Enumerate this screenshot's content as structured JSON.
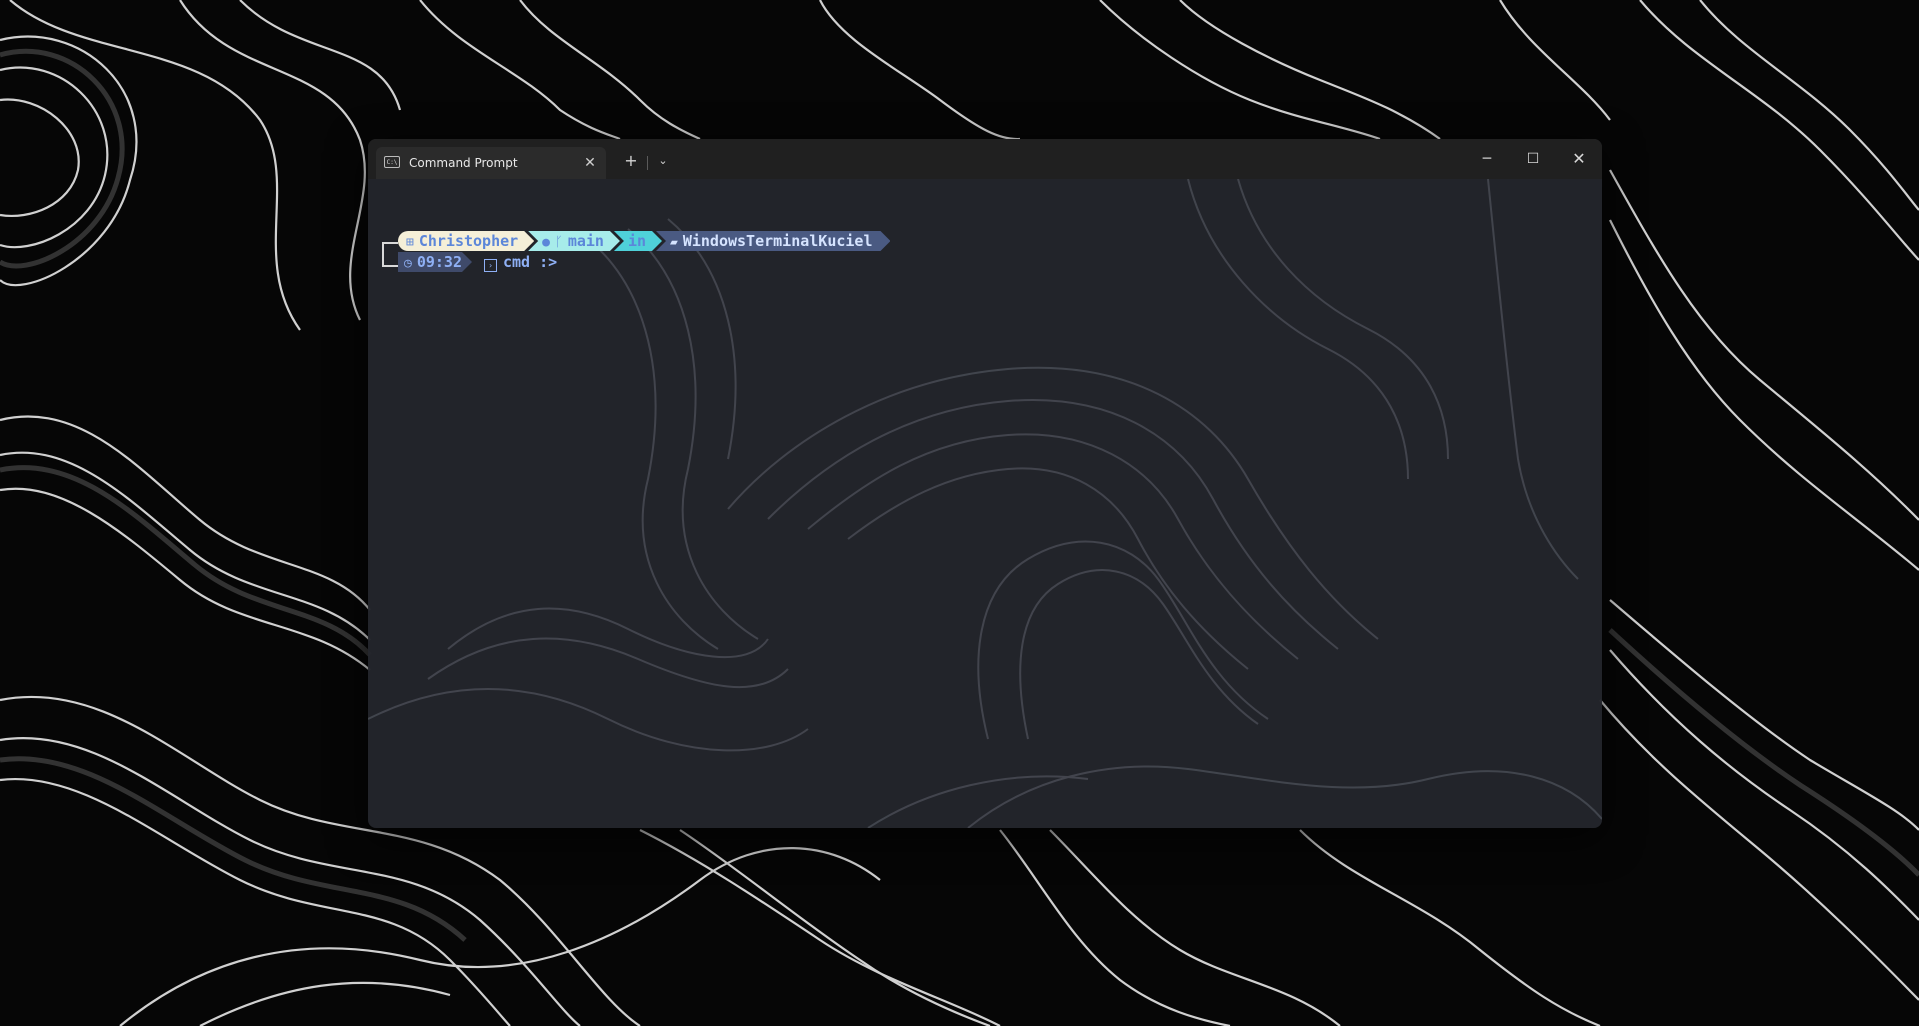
{
  "window": {
    "tab_title": "Command Prompt",
    "tab_icon": "C:\\",
    "tab_close": "✕",
    "new_tab": "+",
    "dropdown": "⌄",
    "minimize": "─",
    "maximize": "☐",
    "close": "✕"
  },
  "prompt": {
    "user": "Christopher",
    "github_icon": "github-icon",
    "branch": "main",
    "in_label": "in",
    "directory": "WindowsTerminalKuciel",
    "time": "09:32",
    "shell": "cmd",
    "cursor": ":>"
  },
  "colors": {
    "user_segment": "#f5efd8",
    "git_segment": "#a7ecea",
    "in_segment": "#4fd1d9",
    "path_segment": "#4a5a82",
    "text_accent": "#5c86d9",
    "terminal_bg": "#23252c",
    "titlebar": "#202020"
  }
}
